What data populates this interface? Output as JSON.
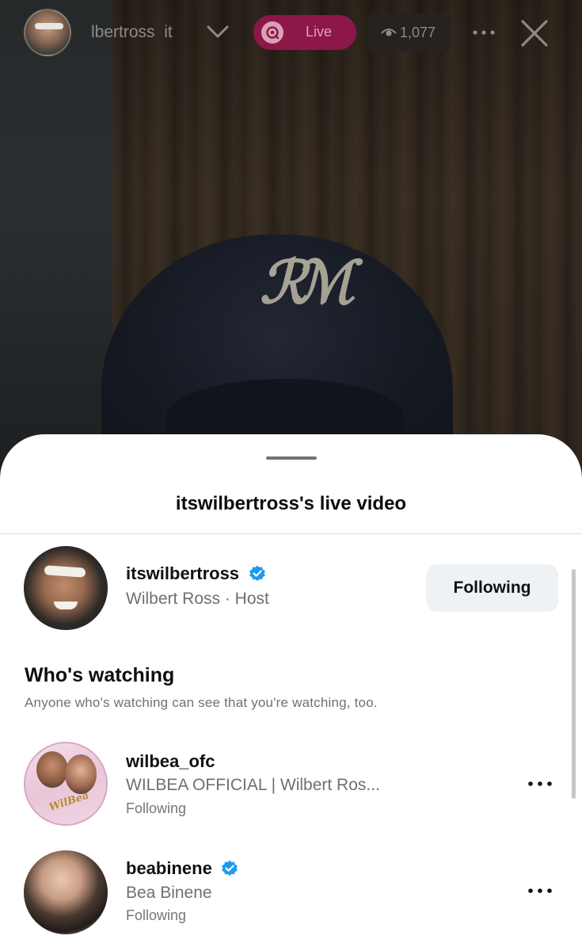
{
  "top_bar": {
    "host_name": "lbertross",
    "host_suffix": "it",
    "live_label": "Live",
    "viewer_count": "1,077"
  },
  "sheet": {
    "title": "itswilbertross's live video",
    "host": {
      "username": "itswilbertross",
      "subtitle": "Wilbert Ross · Host",
      "verified": true,
      "follow_button_label": "Following"
    },
    "watching_section": {
      "title": "Who's watching",
      "note": "Anyone who's watching can see that you're watching, too."
    },
    "viewers": [
      {
        "username": "wilbea_ofc",
        "subtitle": "WILBEA OFFICIAL | Wilbert Ros...",
        "status": "Following",
        "verified": false,
        "avatar_text": "WilBea"
      },
      {
        "username": "beabinene",
        "subtitle": "Bea Binene",
        "status": "Following",
        "verified": true
      }
    ]
  },
  "colors": {
    "live_pill": "#8c1748",
    "verified": "#1d9bf0",
    "following_button_bg": "#eff2f5"
  },
  "icons": {
    "live": "live-broadcast-icon",
    "viewers": "eye-icon",
    "more": "more-dots-icon",
    "close": "close-icon",
    "verified": "verified-badge-icon"
  }
}
